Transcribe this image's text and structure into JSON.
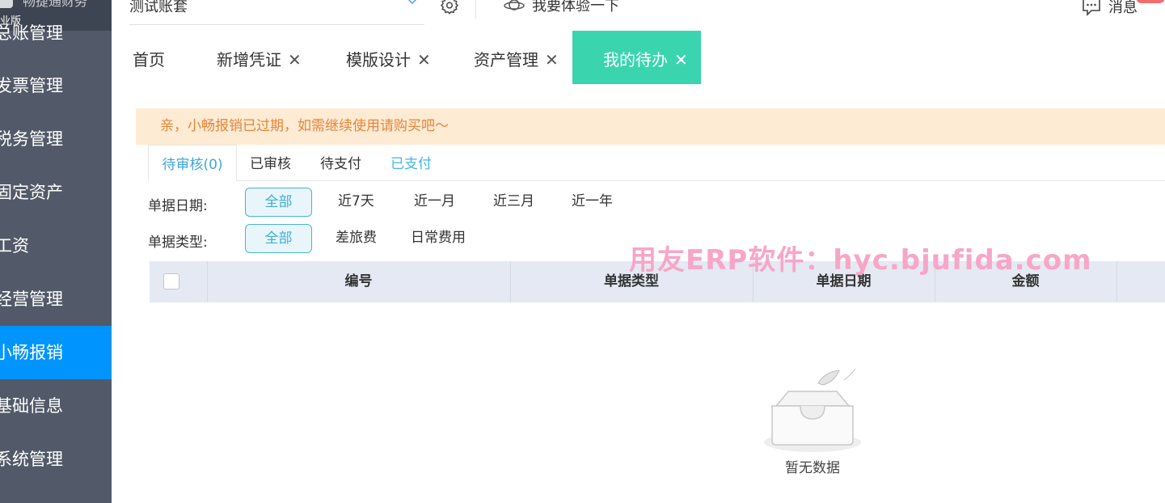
{
  "sidebar": {
    "logo_top": "畅捷通财务",
    "edition": "业版",
    "items": [
      {
        "label": "总账管理",
        "active": false
      },
      {
        "label": "发票管理",
        "active": false
      },
      {
        "label": "税务管理",
        "active": false
      },
      {
        "label": "固定资产",
        "active": false
      },
      {
        "label": "工资",
        "active": false
      },
      {
        "label": "经营管理",
        "active": false
      },
      {
        "label": "小畅报销",
        "active": true
      },
      {
        "label": "基础信息",
        "active": false
      },
      {
        "label": "系统管理",
        "active": false
      }
    ]
  },
  "topbar": {
    "account_value": "测试账套",
    "try_label": "我要体验一下",
    "message_label": "消息"
  },
  "tabs": [
    {
      "label": "首页",
      "closable": false
    },
    {
      "label": "新增凭证",
      "closable": true
    },
    {
      "label": "模版设计",
      "closable": true
    },
    {
      "label": "资产管理",
      "closable": true
    },
    {
      "label": "我的待办",
      "closable": true,
      "active": true
    }
  ],
  "notice": "亲，小畅报销已过期，如需继续使用请购买吧～",
  "status_tabs": [
    "待审核(0)",
    "已审核",
    "待支付",
    "已支付"
  ],
  "filters": {
    "date": {
      "label": "单据日期:",
      "options": [
        "全部",
        "近7天",
        "近一月",
        "近三月",
        "近一年"
      ],
      "selected": "全部"
    },
    "type": {
      "label": "单据类型:",
      "options": [
        "全部",
        "差旅费",
        "日常费用"
      ],
      "selected": "全部"
    }
  },
  "table": {
    "columns": [
      "编号",
      "单据类型",
      "单据日期",
      "金额"
    ],
    "empty_text": "暂无数据"
  },
  "watermark": "用友ERP软件：hyc.bjufida.com",
  "colors": {
    "sidebar_bg": "#525a69",
    "sidebar_active": "#0094ff",
    "tab_active": "#3ad5af",
    "notice_bg": "#fdebd3",
    "notice_text": "#e6853c",
    "link": "#43b6e8",
    "table_header_bg": "#e4e9f3",
    "watermark": "#f7a6c8"
  },
  "icons": {
    "account_dropdown": "chevron-down-icon",
    "settings": "gear-icon",
    "try": "planet-icon",
    "message": "chat-bubble-icon",
    "close": "close-icon",
    "empty": "empty-box-icon"
  }
}
